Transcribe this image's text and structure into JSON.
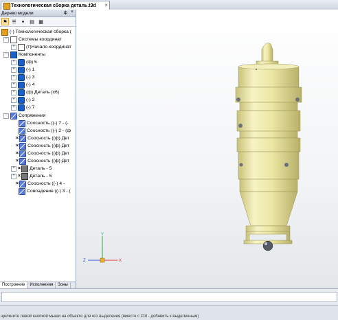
{
  "document_tab": {
    "title": "Технологическая сборка деталь.t3d",
    "close": "×"
  },
  "model_panel": {
    "title": "Дерево модели",
    "pin": "ф",
    "close": "×",
    "tabs": [
      "Построение",
      "Исполнения",
      "Зоны"
    ]
  },
  "tree": {
    "root": "(-) Технологическая сборка (",
    "coord_systems": "Системы координат",
    "origin": "(т)Начало координат",
    "components": "Компоненты",
    "component_items": [
      "(ф) 5",
      "(-) 1",
      "(-) 3",
      "(-) 4",
      "(ф) Деталь (х6)",
      "(-) 2",
      "(-) 7"
    ],
    "mates": "Сопряжения",
    "mate_items": [
      "Соосность ((-) 7 - (-",
      "Соосность ((-) 2 - (ф",
      "Соосность ((ф) Дет",
      "Соосность ((ф) Дет",
      "Соосность ((ф) Дет",
      "Соосность ((ф) Дет",
      "Деталь - 5",
      "Деталь - 5",
      "Соосность ((-) 4 -",
      "Совпадение ((-) 3 - ("
    ]
  },
  "axes": {
    "x": "X",
    "y": "Y",
    "z": "Z"
  },
  "status": {
    "hint": "щелкните левой кнопкой мыши на объекте для его выделения (вместе с Ctrl - добавить к выделенным)"
  },
  "colors": {
    "part": "#ece7a5",
    "part_shade": "#c9c27a",
    "accent": "#1c5fc5"
  }
}
